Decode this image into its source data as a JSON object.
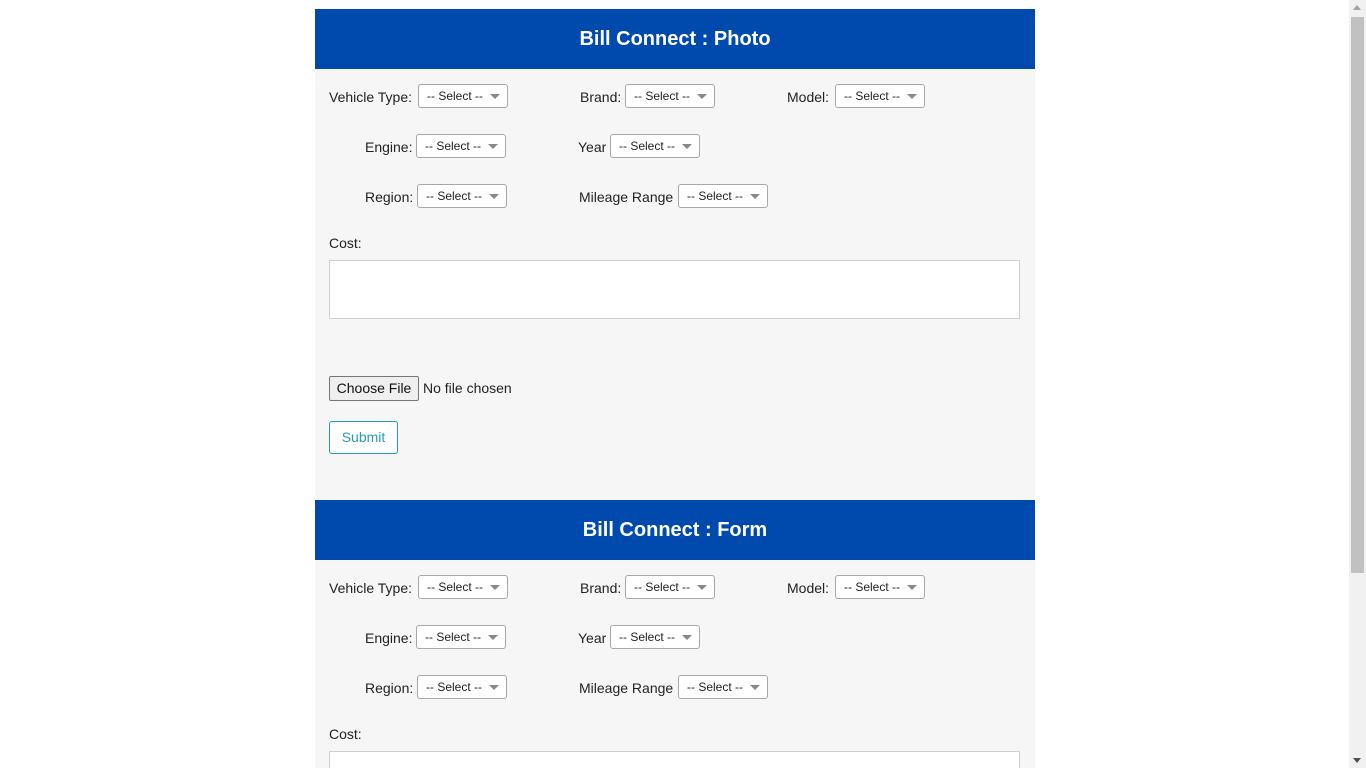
{
  "photo_form": {
    "title": "Bill Connect : Photo",
    "vehicle_type_label": "Vehicle Type:",
    "brand_label": "Brand:",
    "model_label": "Model:",
    "engine_label": "Engine:",
    "year_label": "Year",
    "region_label": "Region:",
    "mileage_label": "Mileage Range",
    "select_value": "-- Select --",
    "cost_label": "Cost:",
    "cost_value": "",
    "choose_file_label": "Choose File",
    "file_status": "No file chosen",
    "submit_label": "Submit"
  },
  "form_form": {
    "title": "Bill Connect : Form",
    "vehicle_type_label": "Vehicle Type:",
    "brand_label": "Brand:",
    "model_label": "Model:",
    "engine_label": "Engine:",
    "year_label": "Year",
    "region_label": "Region:",
    "mileage_label": "Mileage Range",
    "select_value": "-- Select --",
    "cost_label": "Cost:"
  },
  "colors": {
    "header_bg": "#004aad",
    "panel_bg": "#f6f6f6",
    "submit_accent": "#2a9bb5"
  }
}
